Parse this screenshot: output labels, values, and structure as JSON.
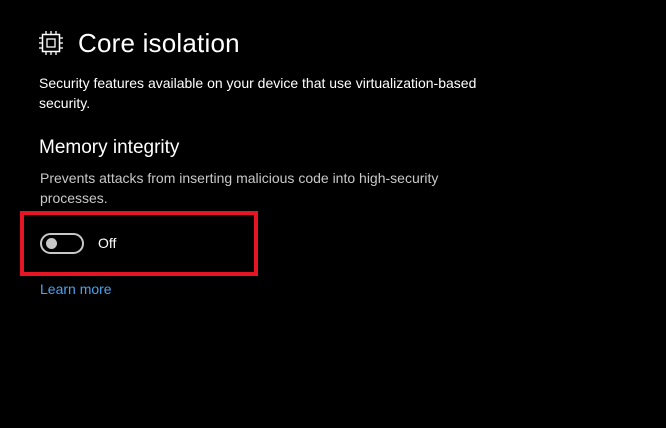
{
  "header": {
    "icon": "chip-icon",
    "title": "Core isolation"
  },
  "description": "Security features available on your device that use virtualization-based security.",
  "memory_integrity": {
    "title": "Memory integrity",
    "description": "Prevents attacks from inserting malicious code into high-security processes.",
    "toggle": {
      "state": "off",
      "label": "Off"
    }
  },
  "learn_more": {
    "label": "Learn more"
  },
  "colors": {
    "background": "#000000",
    "text": "#ffffff",
    "secondary_text": "#c8c8c8",
    "link": "#4aa3f0",
    "highlight": "#e51524"
  }
}
